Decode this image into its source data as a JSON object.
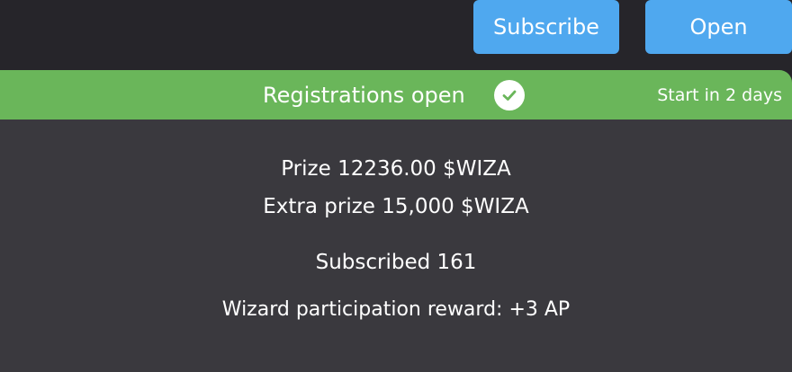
{
  "header": {
    "subscribe_label": "Subscribe",
    "open_label": "Open"
  },
  "banner": {
    "status": "Registrations open",
    "status_icon": "check-circle-icon",
    "start_text": "Start in 2 days"
  },
  "details": {
    "prize": "Prize 12236.00 $WIZA",
    "extra_prize": "Extra prize 15,000 $WIZA",
    "subscribed": "Subscribed 161",
    "participation_reward": "Wizard participation reward: +3 AP"
  },
  "colors": {
    "background": "#26252a",
    "card": "#3a393e",
    "banner_green": "#6ab65a",
    "button_blue": "#4fa8ef",
    "text": "#ffffff"
  }
}
